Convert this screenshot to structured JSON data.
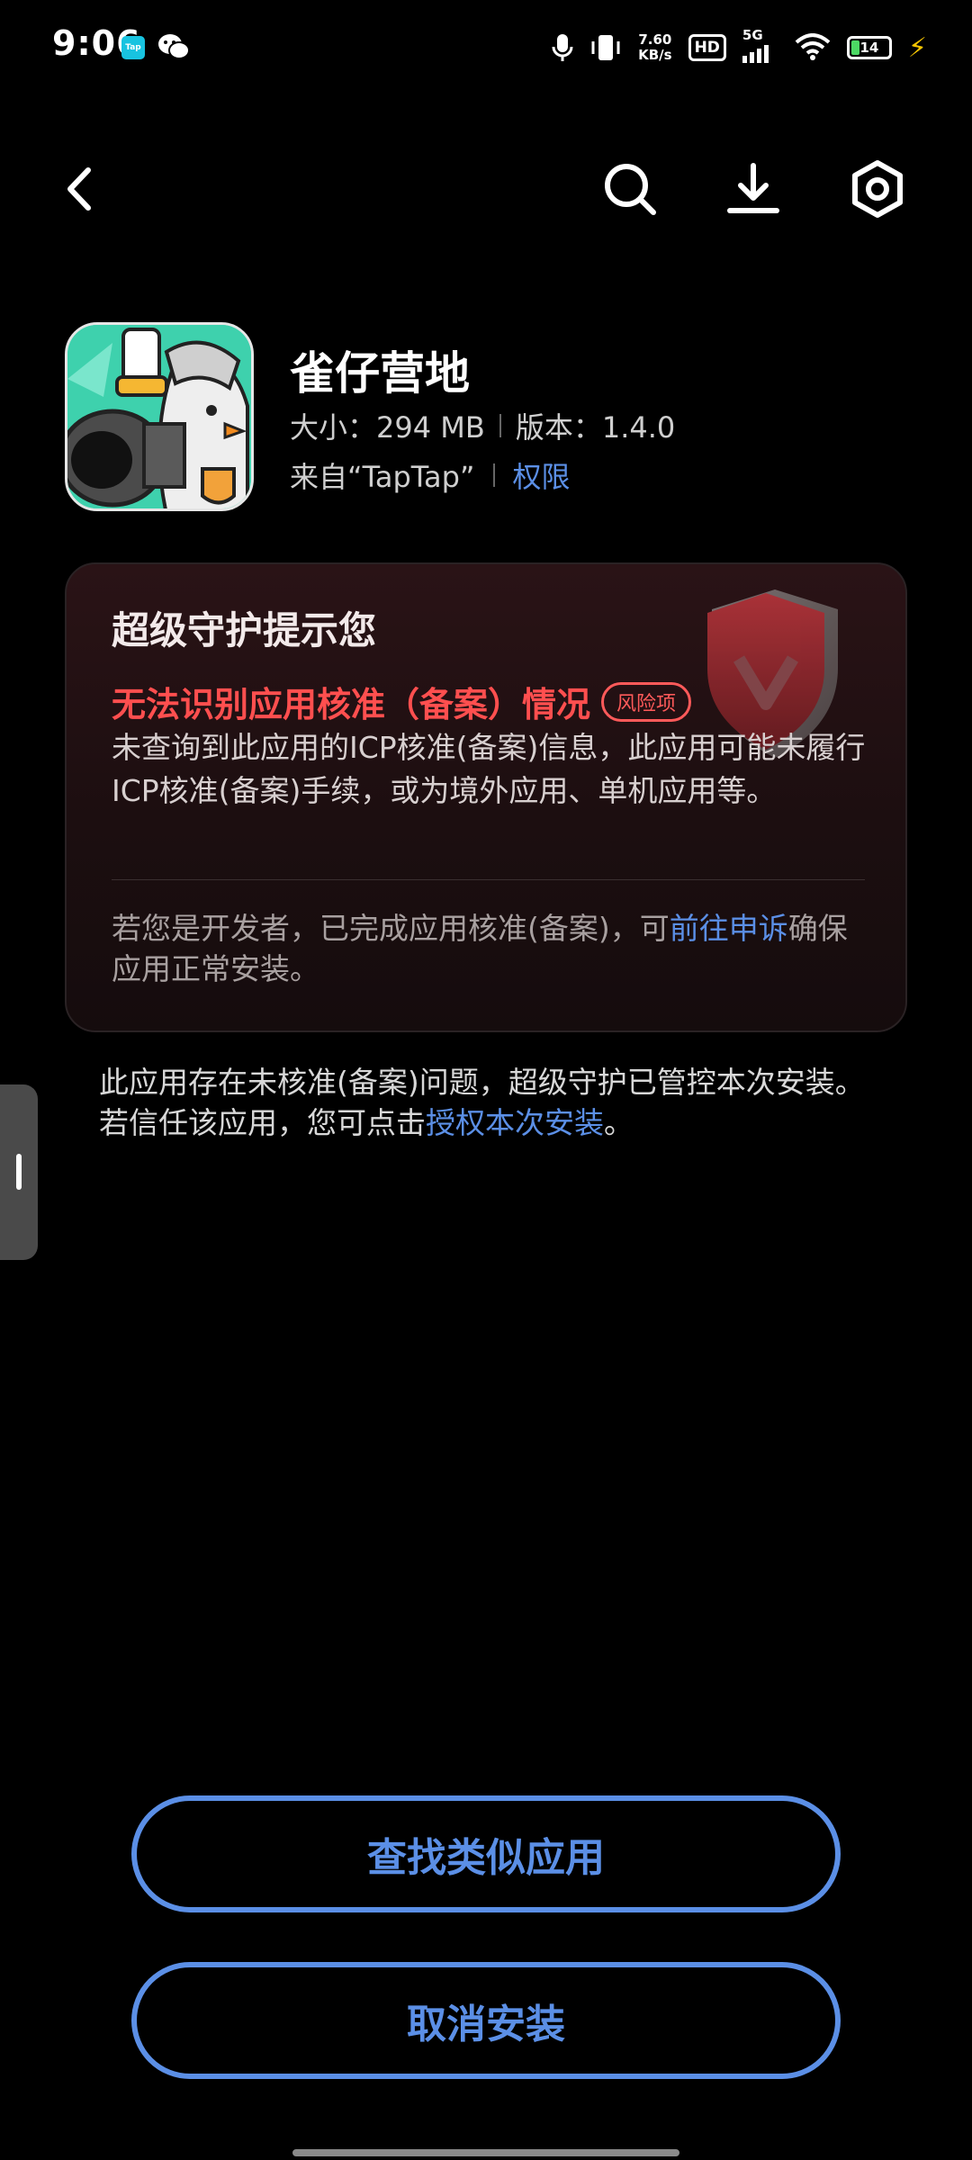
{
  "status_bar": {
    "time": "9:06",
    "taptap_badge": "Tap",
    "net_speed_value": "7.60",
    "net_speed_unit": "KB/s",
    "hd": "HD",
    "network": "5G",
    "battery_level": "14"
  },
  "nav": {
    "back_icon": "chevron-left-icon",
    "search_icon": "search-icon",
    "download_icon": "download-icon",
    "settings_icon": "settings-icon"
  },
  "app": {
    "name": "雀仔营地",
    "size_label": "大小：294 MB",
    "version_label": "版本：1.4.0",
    "source_label": "来自“TapTap”",
    "permissions_link": "权限"
  },
  "card": {
    "title": "超级守护提示您",
    "warning_title": "无法识别应用核准（备案）情况",
    "risk_badge": "风险项",
    "warning_body": "未查询到此应用的ICP核准(备案)信息，此应用可能未履行ICP核准(备案)手续，或为境外应用、单机应用等。",
    "developer_note_prefix": "若您是开发者，已完成应用核准(备案)，可",
    "developer_note_link": "前往申诉",
    "developer_note_suffix": "确保应用正常安装。"
  },
  "notice": {
    "prefix": "此应用存在未核准(备案)问题，超级守护已管控本次安装。若信任该应用，您可点击",
    "link": "授权本次安装",
    "suffix": "。"
  },
  "buttons": {
    "find_similar": "查找类似应用",
    "cancel_install": "取消安装"
  },
  "colors": {
    "accent": "#5b8fe6",
    "warning": "#ff4f4f",
    "background": "#000000"
  }
}
